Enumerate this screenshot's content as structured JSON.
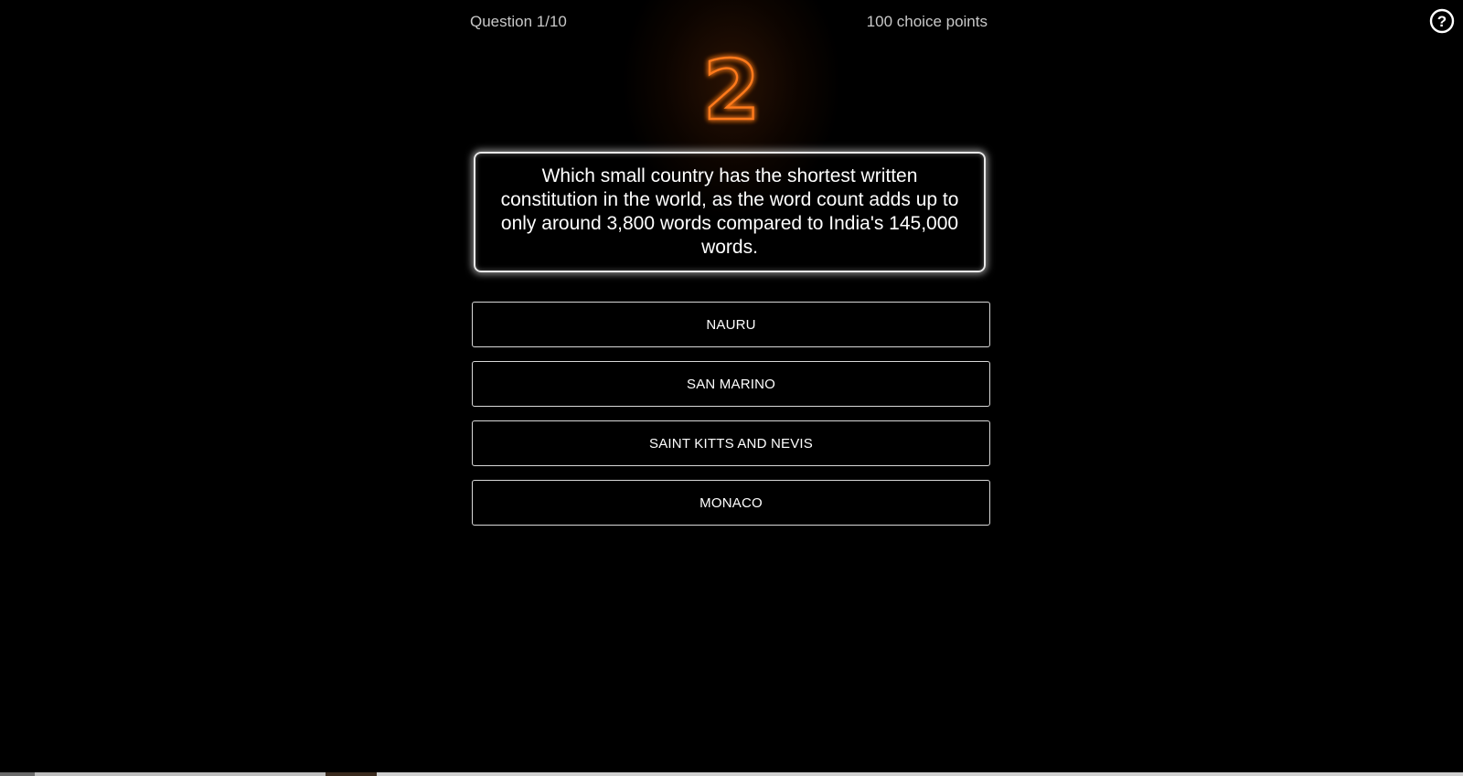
{
  "header": {
    "question_counter": "Question 1/10",
    "points": "100 choice points"
  },
  "help": {
    "icon": "question-mark-circle-icon",
    "glyph": "?"
  },
  "timer": {
    "value": "2",
    "color": "#ff7a1a"
  },
  "question": {
    "text": "Which small country has the shortest written constitution in the world, as the word count adds up to only around 3,800 words compared to India's 145,000 words."
  },
  "answers": [
    {
      "label": "NAURU"
    },
    {
      "label": "SAN MARINO"
    },
    {
      "label": "SAINT KITTS AND NEVIS"
    },
    {
      "label": "MONACO"
    }
  ]
}
